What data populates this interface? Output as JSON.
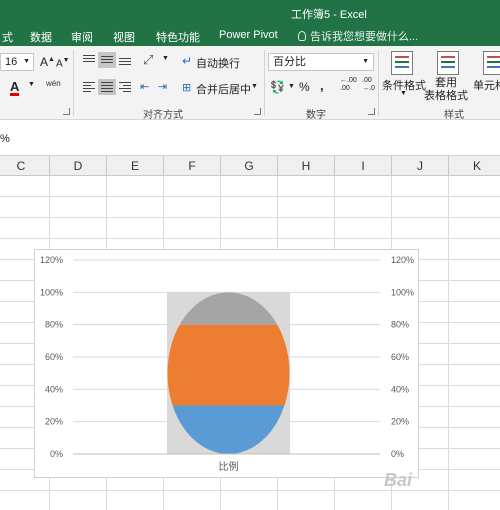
{
  "window": {
    "title": "工作簿5 - Excel"
  },
  "ribbon_tabs": [
    "式",
    "数据",
    "审阅",
    "视图",
    "特色功能",
    "Power Pivot"
  ],
  "tell_me": "告诉我您想要做什么...",
  "font": {
    "size": "16",
    "grow": "A",
    "shrink": "A",
    "color_glyph": "A",
    "phonetic": "wén"
  },
  "alignment": {
    "wrap_text": "自动换行",
    "merge_center": "合并后居中",
    "group_label": "对齐方式"
  },
  "number": {
    "format": "百分比",
    "percent": "%",
    "comma": ",",
    "group_label": "数字",
    "inc_decimal": "←.00\n.00",
    "dec_decimal": ".00\n→.0"
  },
  "styles": {
    "conditional": "条件格式",
    "table_format": "套用\n表格格式",
    "group_label": "样式",
    "cell_styles": "单元格"
  },
  "name_box": "%",
  "columns": [
    "C",
    "D",
    "E",
    "F",
    "G",
    "H",
    "I",
    "J",
    "K"
  ],
  "chart_data": {
    "type": "bar",
    "xlabel": "比例",
    "categories": [
      "比例"
    ],
    "ylim": [
      0,
      1.2
    ],
    "yticks": [
      "0%",
      "20%",
      "40%",
      "60%",
      "80%",
      "100%",
      "120%"
    ],
    "series": [
      {
        "values": [
          0.3
        ],
        "color": "#5B9BD5"
      },
      {
        "values": [
          0.5
        ],
        "color": "#ED7D31"
      },
      {
        "values": [
          0.2
        ],
        "color": "#A5A5A5"
      }
    ],
    "background_bar": {
      "values": [
        1.0
      ],
      "color": "#D9D9D9"
    },
    "secondary_axis": true,
    "grid": true
  },
  "watermark": "Bai"
}
